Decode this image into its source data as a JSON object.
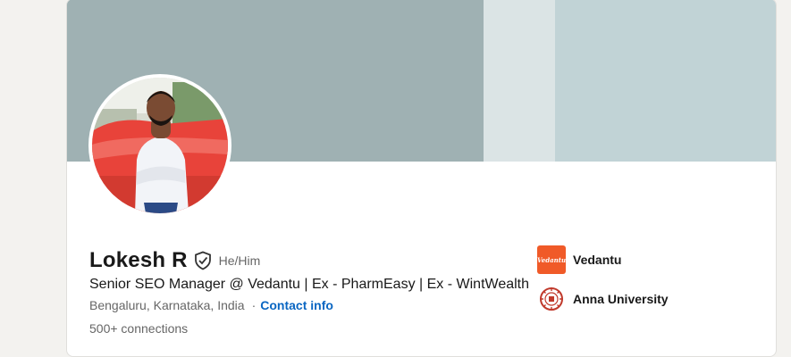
{
  "profile": {
    "name": "Lokesh R",
    "pronouns": "He/Him",
    "headline": "Senior SEO Manager @ Vedantu | Ex - PharmEasy | Ex - WintWealth",
    "location": "Bengaluru, Karnataka, India",
    "separator": "·",
    "contact_label": "Contact info",
    "connections": "500+ connections"
  },
  "organizations": [
    {
      "name": "Vedantu",
      "logo_text": "Vedantu",
      "icon": "vedantu-logo",
      "color": "#f05a28"
    },
    {
      "name": "Anna University",
      "icon": "anna-university-logo",
      "color": "#c0392b"
    }
  ],
  "colors": {
    "banner_light": "#c1d3d6",
    "banner_dark": "#9fb1b3",
    "link": "#0a66c2",
    "background": "#f3f2ef"
  }
}
